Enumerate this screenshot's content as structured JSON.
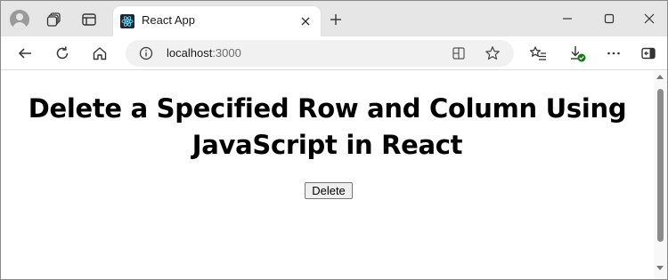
{
  "browser": {
    "tab": {
      "title": "React App",
      "favicon": "react-logo-icon"
    },
    "new_tab_icon": "plus-icon",
    "address_bar": {
      "host": "localhost",
      "port": ":3000",
      "info_icon": "info-icon"
    },
    "toolbar_icons": [
      "back-arrow-icon",
      "refresh-icon",
      "home-icon",
      "split-screen-icon",
      "favorite-star-icon",
      "favorites-list-icon",
      "downloads-icon",
      "more-options-icon",
      "sidebar-icon"
    ],
    "window_controls": [
      "minimize-icon",
      "maximize-icon",
      "close-icon"
    ],
    "colors": {
      "tab_strip": "#e6e6e6",
      "download_badge": "#107c10",
      "react_blue": "#61dafb"
    }
  },
  "page": {
    "heading": "Delete a Specified Row and Column Using JavaScript in React",
    "delete_button_label": "Delete"
  }
}
